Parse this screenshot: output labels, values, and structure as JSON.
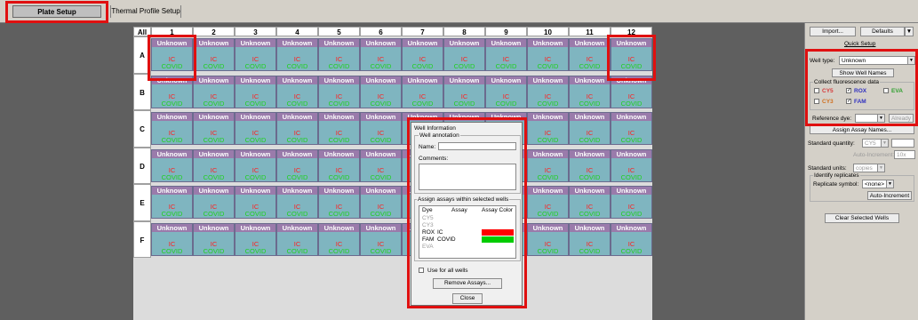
{
  "tabs": {
    "plate_setup": "Plate Setup",
    "thermal_profile": "Thermal Profile Setup"
  },
  "plate": {
    "corner_label": "All",
    "columns": [
      "1",
      "2",
      "3",
      "4",
      "5",
      "6",
      "7",
      "8",
      "9",
      "10",
      "11",
      "12"
    ],
    "rows": [
      "A",
      "B",
      "C",
      "D",
      "E",
      "F"
    ],
    "well_name": "Unknown",
    "assay_1": "IC",
    "assay_2": "COVID",
    "colors": {
      "well_bg": "#7fb5c0",
      "well_header": "#9a7bab",
      "ic": "#ff2020",
      "covid": "#20d020",
      "highlight": "#e01010"
    }
  },
  "dialog": {
    "title": "Well Information",
    "annotation_group": "Well annotation",
    "name_label": "Name:",
    "name_value": "",
    "comments_label": "Comments:",
    "assign_group": "Assign assays within selected wells",
    "table_headers": {
      "dye": "Dye",
      "assay": "Assay",
      "color": "Assay Color"
    },
    "dyes": [
      {
        "dye": "CY5",
        "assay": "",
        "enabled": false
      },
      {
        "dye": "CY3",
        "assay": "",
        "enabled": false
      },
      {
        "dye": "ROX",
        "assay": "IC",
        "enabled": true,
        "color": "#ff0000"
      },
      {
        "dye": "FAM",
        "assay": "COVID",
        "enabled": true,
        "color": "#00cc00"
      },
      {
        "dye": "EVA",
        "assay": "",
        "enabled": false
      }
    ],
    "use_for_all": "Use for all wells",
    "remove_button": "Remove Assays...",
    "close_button": "Close"
  },
  "panel": {
    "import_button": "Import...",
    "defaults_button": "Defaults",
    "quick_setup": "Quick Setup",
    "well_type_label": "Well type:",
    "well_type_value": "Unknown",
    "show_names_button": "Show Well Names",
    "collect_group": "Collect fluorescence data",
    "fluor": [
      {
        "name": "CY5",
        "checked": false,
        "color": "#d63a3a"
      },
      {
        "name": "ROX",
        "checked": true,
        "color": "#3030c0"
      },
      {
        "name": "EVA",
        "checked": false,
        "color": "#30a030"
      },
      {
        "name": "CY3",
        "checked": false,
        "color": "#d07020"
      },
      {
        "name": "FAM",
        "checked": true,
        "color": "#3030c0"
      }
    ],
    "reference_dye_label": "Reference dye:",
    "reference_dye_value": "",
    "already_label": "Already",
    "assign_assay_button": "Assign Assay Names...",
    "standard_quantity_label": "Standard quantity:",
    "standard_quantity_dye": "CY5",
    "auto_increment_label": "Auto-Increment:",
    "auto_increment_value": "10x",
    "standard_units_label": "Standard units:",
    "standard_units_value": "copies",
    "identify_replicates": "Identify replicates",
    "replicate_symbol_label": "Replicate symbol:",
    "replicate_symbol_value": "<none>",
    "auto_increment_button": "Auto-Increment",
    "clear_button": "Clear Selected Wells"
  }
}
